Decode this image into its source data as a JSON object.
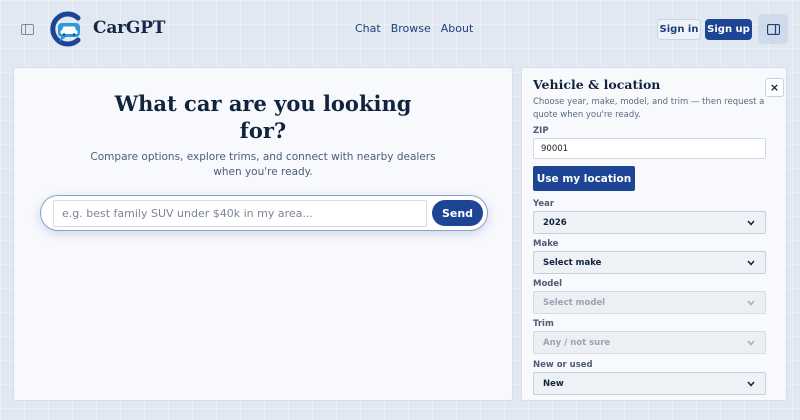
{
  "header": {
    "brand": "CarGPT",
    "nav": [
      {
        "label": "Chat"
      },
      {
        "label": "Browse"
      },
      {
        "label": "About"
      }
    ],
    "sign_in": "Sign in",
    "sign_up": "Sign up"
  },
  "main": {
    "title": "What car are you looking for?",
    "subtitle": "Compare options, explore trims, and connect with nearby dealers when you're ready.",
    "input_placeholder": "e.g. best family SUV under $40k in my area...",
    "send_label": "Send"
  },
  "panel": {
    "title": "Vehicle & location",
    "close": "×",
    "description": "Choose year, make, model, and trim — then request a quote when you're ready.",
    "zip_label": "ZIP",
    "zip_value": "90001",
    "use_location": "Use my location",
    "year_label": "Year",
    "year_value": "2026",
    "make_label": "Make",
    "make_value": "Select make",
    "model_label": "Model",
    "model_value": "Select model",
    "trim_label": "Trim",
    "trim_value": "Any / not sure",
    "condition_label": "New or used",
    "condition_value": "New"
  },
  "colors": {
    "accent": "#1e4595",
    "page_bg": "#e2e8f1",
    "card_bg": "#f7f9fc"
  }
}
